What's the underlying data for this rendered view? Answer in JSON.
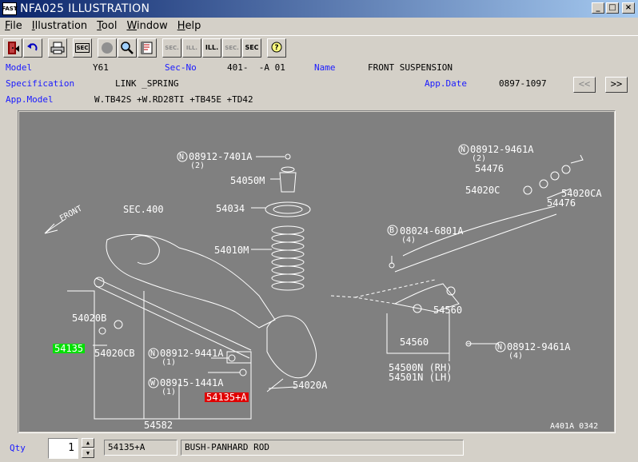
{
  "window": {
    "title": "NFA025 ILLUSTRATION",
    "icon_label": "FAST",
    "minimize": "_",
    "maximize": "□",
    "close": "×"
  },
  "menu": [
    {
      "label": "File",
      "u": "F",
      "rest": "ile"
    },
    {
      "label": "Illustration",
      "u": "I",
      "rest": "llustration"
    },
    {
      "label": "Tool",
      "u": "T",
      "rest": "ool"
    },
    {
      "label": "Window",
      "u": "W",
      "rest": "indow"
    },
    {
      "label": "Help",
      "u": "H",
      "rest": "elp"
    }
  ],
  "toolbar": {
    "sec_label": "SEC",
    "sec_sm": "SEC.",
    "ill_sm": "ILL.",
    "ill_bold": "ILL.",
    "sec_q": "SEC"
  },
  "info": {
    "model_label": "Model",
    "model_value": "Y61",
    "secno_label": "Sec-No",
    "secno_value": "401-  -A 01",
    "name_label": "Name",
    "name_value": "FRONT SUSPENSION",
    "spec_label": "Specification",
    "spec_value": "LINK _SPRING",
    "appdate_label": "App.Date",
    "appdate_value": "0897-1097",
    "appmodel_label": "App.Model",
    "appmodel_value": "W.TB42S +W.RD28TI +TB45E +TD42",
    "prev": "<<",
    "next": ">>"
  },
  "illustration": {
    "labels": {
      "n08912_7401a": "08912-7401A",
      "qty2a": "(2)",
      "p54050m": "54050M",
      "p54034": "54034",
      "p54010m": "54010M",
      "sec400": "SEC.400",
      "front": "FRONT",
      "n08912_9461a_top": "08912-9461A",
      "qty2b": "(2)",
      "p54476a": "54476",
      "p54020c": "54020C",
      "p54020ca": "54020CA",
      "p54476b": "54476",
      "b08024_6801a": "08024-6801A",
      "qty4a": "(4)",
      "p54020b": "54020B",
      "p54135_green": "54135",
      "p54020cb": "54020CB",
      "n08912_9441a": "08912-9441A",
      "qty1a": "(1)",
      "w08915_1441a": "08915-1441A",
      "qty1b": "(1)",
      "p54135a_red": "54135+A",
      "p54020a": "54020A",
      "p54582": "54582",
      "p54560a": "54560",
      "p54560b": "54560",
      "n08912_9461a_bot": "08912-9461A",
      "qty4b": "(4)",
      "p54500n": "54500N (RH)",
      "p54501n": "54501N (LH)",
      "ref": "A401A 0342",
      "n": "N",
      "b": "B",
      "w": "W"
    }
  },
  "bottom": {
    "qty_label": "Qty",
    "qty_value": "1",
    "part_no": "54135+A",
    "part_name": "BUSH-PANHARD ROD"
  }
}
